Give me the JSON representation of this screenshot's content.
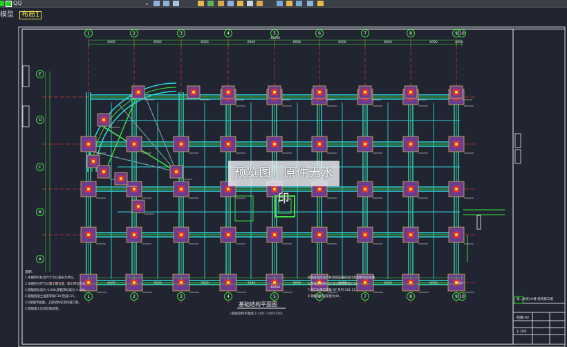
{
  "toolbar": {
    "layer_name": "QQ",
    "layer_color": "#1fd61f"
  },
  "tabs": [
    {
      "label": "模型"
    },
    {
      "label": "布局1"
    }
  ],
  "drawing": {
    "title": "基础结构平面图",
    "subtitle": "(基础结构平面图 1:100 / 200X150)",
    "notes_heading": "说明:",
    "notes_left": [
      "1.本图所有标注尺寸均以毫米为单位。",
      "2.本图所注尺寸以施工图为准，施工时应核对。",
      "3.基础底标高为-3.400,基础顶标高为-1.400。",
      "4.基础混凝土强度等级C30,垫层C15。",
      "1/3基础平面图，上部结构详见柱施工图。",
      "5.基础施工详见结施说明。"
    ],
    "notes_right": [
      "基础开挖至设计标高后应通知设计及勘察单位验槽。",
      "6.基础垫层厚100,每边宽出基础100。",
      "7.施工时参见图集 97 系列-561,22。",
      "8.钢筋保护层厚度为40。"
    ],
    "axes_top": [
      "1",
      "2",
      "3",
      "4",
      "5",
      "6",
      "7",
      "8",
      "9",
      "10"
    ],
    "axes_bottom": [
      "1",
      "2",
      "3",
      "4",
      "5",
      "6",
      "7",
      "8",
      "9",
      "10"
    ],
    "axes_left": [
      "E",
      "D",
      "C",
      "B",
      "A"
    ],
    "dims_top": [
      "6000",
      "6000",
      "6000",
      "6000",
      "6000",
      "6000",
      "6000",
      "6000",
      "6000"
    ],
    "dims_bottom": [
      "6000",
      "6000",
      "3000",
      "3000",
      "6000",
      "6000",
      "6000",
      "6000",
      "6000"
    ],
    "total_dim": "48000",
    "titleblock": {
      "project_label": "某...地块1#楼 结构施工图",
      "drawing_no": "结施-02",
      "scale": "1:100"
    }
  }
}
